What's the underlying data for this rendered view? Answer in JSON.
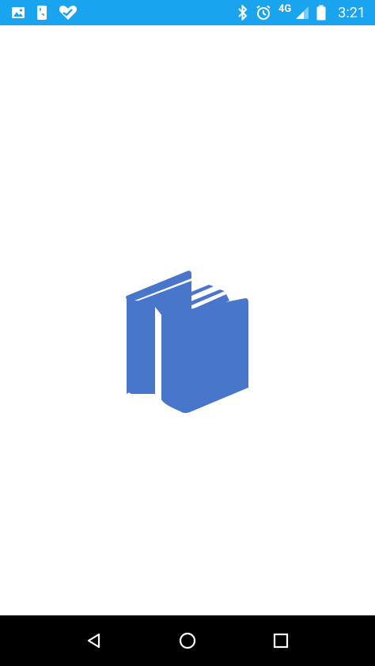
{
  "status_bar": {
    "time": "3:21",
    "network": "4G",
    "left_icons": [
      "image-icon",
      "phone-icon",
      "heart-check-icon"
    ],
    "right_icons": [
      "bluetooth-icon",
      "alarm-icon",
      "signal-icon",
      "battery-icon"
    ],
    "background_color": "#1aa3ee"
  },
  "splash": {
    "logo_icon": "books-icon",
    "logo_color": "#4876cb"
  },
  "nav_bar": {
    "buttons": [
      "back-icon",
      "home-icon",
      "recents-icon"
    ],
    "background_color": "#000000"
  }
}
